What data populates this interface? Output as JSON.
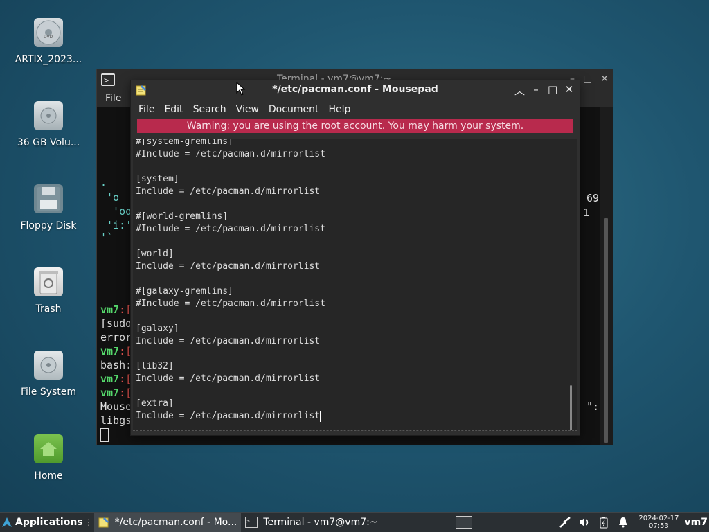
{
  "desktop": {
    "icons": [
      {
        "label": "ARTIX_2023..."
      },
      {
        "label": "36 GB Volu..."
      },
      {
        "label": "Floppy Disk"
      },
      {
        "label": "Trash"
      },
      {
        "label": "File System"
      },
      {
        "label": "Home"
      }
    ]
  },
  "terminal": {
    "title": "Terminal - vm7@vm7:~",
    "menu_file": "File",
    "left_lines": [
      {
        "text": ".",
        "cls": "cyan"
      },
      {
        "text": " 'o",
        "cls": "cyan"
      },
      {
        "text": "  'oo",
        "cls": "cyan"
      },
      {
        "text": " 'i:'",
        "cls": "cyan"
      },
      {
        "text": "'`",
        "cls": "cyan"
      },
      {
        "text": "vm7",
        "cls": "green",
        "suffix": ":["
      },
      {
        "text": "[sudo",
        "cls": ""
      },
      {
        "text": "error",
        "cls": ""
      },
      {
        "text": "vm7",
        "cls": "green",
        "suffix": ":["
      },
      {
        "text": "bash:",
        "cls": ""
      },
      {
        "text": "vm7",
        "cls": "green",
        "suffix": ":["
      },
      {
        "text": "vm7",
        "cls": "green",
        "suffix": ":["
      },
      {
        "text": "Mouse",
        "cls": ""
      },
      {
        "text": "libgs",
        "cls": ""
      }
    ],
    "right_lines": [
      "69",
      "1",
      "\":"
    ]
  },
  "mousepad": {
    "title": "*/etc/pacman.conf - Mousepad",
    "menu": [
      "File",
      "Edit",
      "Search",
      "View",
      "Document",
      "Help"
    ],
    "warning": "Warning: you are using the root account. You may harm your system.",
    "lines": [
      "#[system-gremlins]",
      "#Include = /etc/pacman.d/mirrorlist",
      "",
      "[system]",
      "Include = /etc/pacman.d/mirrorlist",
      "",
      "#[world-gremlins]",
      "#Include = /etc/pacman.d/mirrorlist",
      "",
      "[world]",
      "Include = /etc/pacman.d/mirrorlist",
      "",
      "#[galaxy-gremlins]",
      "#Include = /etc/pacman.d/mirrorlist",
      "",
      "[galaxy]",
      "Include = /etc/pacman.d/mirrorlist",
      "",
      "[lib32]",
      "Include = /etc/pacman.d/mirrorlist",
      "",
      "[extra]",
      "Include = /etc/pacman.d/mirrorlist"
    ]
  },
  "taskbar": {
    "applications_label": "Applications",
    "tasks": [
      {
        "label": "*/etc/pacman.conf - Mo...",
        "icon": "mousepad-icon",
        "active": true
      },
      {
        "label": "Terminal - vm7@vm7:~",
        "icon": "terminal-icon",
        "active": false
      }
    ],
    "clock_date": "2024-02-17",
    "clock_time": "07:53",
    "user": "vm7"
  }
}
